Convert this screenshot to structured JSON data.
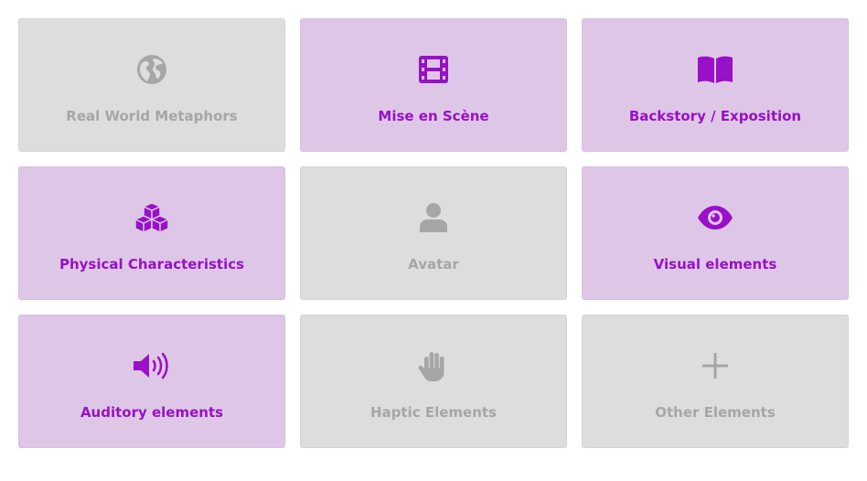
{
  "colors": {
    "active": "#9810c7",
    "active_bg": "#dec7e6",
    "inactive": "#a6a6a6",
    "inactive_bg": "#dddddd"
  },
  "tiles": [
    {
      "label": "Real World Metaphors",
      "icon": "globe-icon",
      "selected": false
    },
    {
      "label": "Mise en Scène",
      "icon": "film-icon",
      "selected": true
    },
    {
      "label": "Backstory / Exposition",
      "icon": "book-icon",
      "selected": true
    },
    {
      "label": "Physical Characteristics",
      "icon": "cubes-icon",
      "selected": true
    },
    {
      "label": "Avatar",
      "icon": "user-icon",
      "selected": false
    },
    {
      "label": "Visual elements",
      "icon": "eye-icon",
      "selected": true
    },
    {
      "label": "Auditory elements",
      "icon": "volume-icon",
      "selected": true
    },
    {
      "label": "Haptic Elements",
      "icon": "hand-icon",
      "selected": false
    },
    {
      "label": "Other Elements",
      "icon": "plus-icon",
      "selected": false
    }
  ]
}
